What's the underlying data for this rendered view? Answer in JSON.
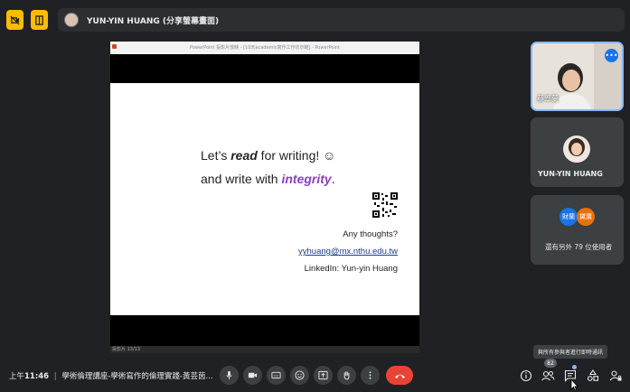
{
  "meeting": {
    "presenter_label": "YUN-YIN HUANG (分享螢幕畫面)",
    "clock_period": "上午",
    "clock_time": "11:46",
    "meeting_title": "學術倫理講座-學術寫作的倫理實踐-黃芸茵..."
  },
  "presentation": {
    "window_title": "PowerPoint 投影片放映 - [10天academic寫作工作坊示範] - PowerPoint",
    "line1_pre": "Let’s ",
    "line1_em": "read",
    "line1_post": " for writing! ☺",
    "line2_pre": "and write with ",
    "line2_em": "integrity",
    "line2_post": ".",
    "any_thoughts": "Any thoughts?",
    "email": "yyhuang@mx.nthu.edu.tw",
    "linkedin": "LinkedIn: Yun-yin Huang",
    "slide_counter": "投影片 13/13"
  },
  "participants": {
    "tile1_name": "蔡翠蘭",
    "tile2_name": "YUN-YIN HUANG",
    "avatar_a": "財蘭",
    "avatar_b": "黛廣",
    "others": "還有另外 79 位使用者",
    "count": "82",
    "tooltip": "與所有參與者進行即時通訊"
  },
  "colors": {
    "accent_purple": "#8b3fbf",
    "end_call": "#ea4335",
    "highlight": "#fbbc04",
    "active_blue": "#8ab4f8"
  }
}
